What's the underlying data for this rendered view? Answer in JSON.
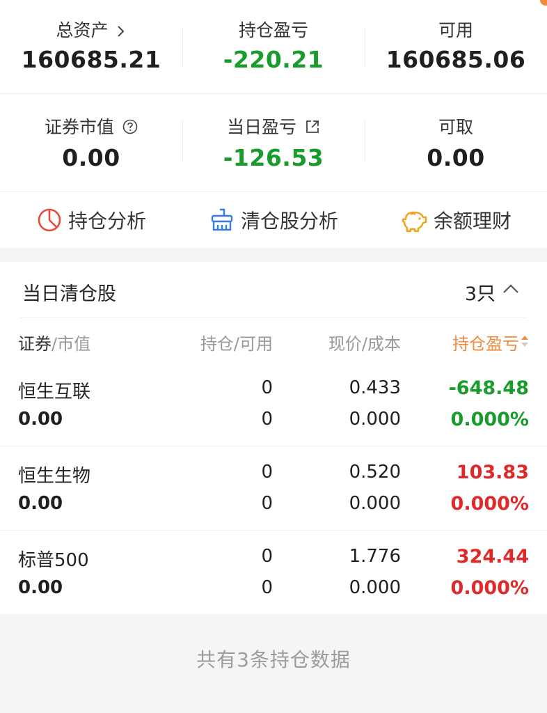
{
  "summary": {
    "total_assets_label": "总资产",
    "total_assets_value": "160685.21",
    "position_pl_label": "持仓盈亏",
    "position_pl_value": "-220.21",
    "available_label": "可用",
    "available_value": "160685.06",
    "securities_value_label": "证券市值",
    "securities_value": "0.00",
    "daily_pl_label": "当日盈亏",
    "daily_pl_value": "-126.53",
    "withdrawable_label": "可取",
    "withdrawable_value": "0.00"
  },
  "actions": {
    "position_analysis": "持仓分析",
    "cleared_analysis": "清仓股分析",
    "wealth": "余额理财"
  },
  "panel": {
    "title": "当日清仓股",
    "count": "3只"
  },
  "table": {
    "headers": {
      "security": "证券",
      "market_value": "/市值",
      "holding": "持仓/可用",
      "price": "现价/成本",
      "pl": "持仓盈亏"
    },
    "rows": [
      {
        "name": "恒生互联",
        "market_value": "0.00",
        "holding": "0",
        "available": "0",
        "price": "0.433",
        "cost": "0.000",
        "pl": "-648.48",
        "pl_pct": "0.000%",
        "color": "#1a9c2c"
      },
      {
        "name": "恒生生物",
        "market_value": "0.00",
        "holding": "0",
        "available": "0",
        "price": "0.520",
        "cost": "0.000",
        "pl": "103.83",
        "pl_pct": "0.000%",
        "color": "#e02a2a"
      },
      {
        "name": "标普500",
        "market_value": "0.00",
        "holding": "0",
        "available": "0",
        "price": "1.776",
        "cost": "0.000",
        "pl": "324.44",
        "pl_pct": "0.000%",
        "color": "#e02a2a"
      }
    ]
  },
  "footer": {
    "text": "共有3条持仓数据"
  },
  "colors": {
    "gain": "#e02a2a",
    "loss": "#1a9c2c",
    "accent": "#f08a3c"
  }
}
